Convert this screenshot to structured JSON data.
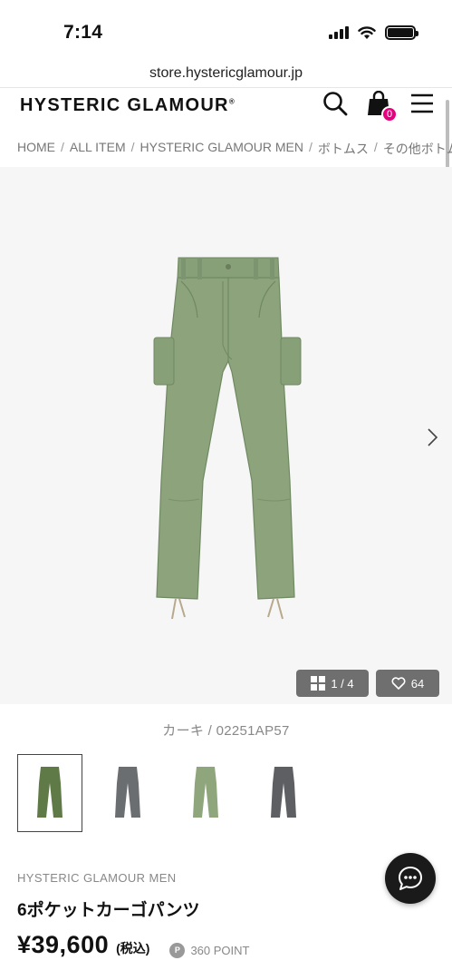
{
  "status_bar": {
    "time": "7:14"
  },
  "browser": {
    "url": "store.hystericglamour.jp"
  },
  "header": {
    "logo": "HYSTERIC GLAMOUR",
    "logo_mark": "®",
    "cart_count": "0"
  },
  "breadcrumb": [
    "HOME",
    "ALL ITEM",
    "HYSTERIC GLAMOUR MEN",
    "ボトムス",
    "その他ボトムス"
  ],
  "gallery": {
    "counter": "1 / 4",
    "likes": "64"
  },
  "product": {
    "color_sku": "カーキ / 02251AP57",
    "brand": "HYSTERIC GLAMOUR MEN",
    "name": "6ポケットカーゴパンツ",
    "price": "¥39,600",
    "tax_note": "(税込)",
    "point_badge": "P",
    "points": "360 POINT"
  },
  "thumbnails": [
    {
      "name": "khaki",
      "color": "#5f7a47"
    },
    {
      "name": "gray",
      "color": "#6b6e71"
    },
    {
      "name": "light-khaki",
      "color": "#8fa57c"
    },
    {
      "name": "charcoal",
      "color": "#5d5f62"
    }
  ],
  "colors": {
    "accent_pink": "#e6007e",
    "pants_khaki": "#8da37c"
  }
}
